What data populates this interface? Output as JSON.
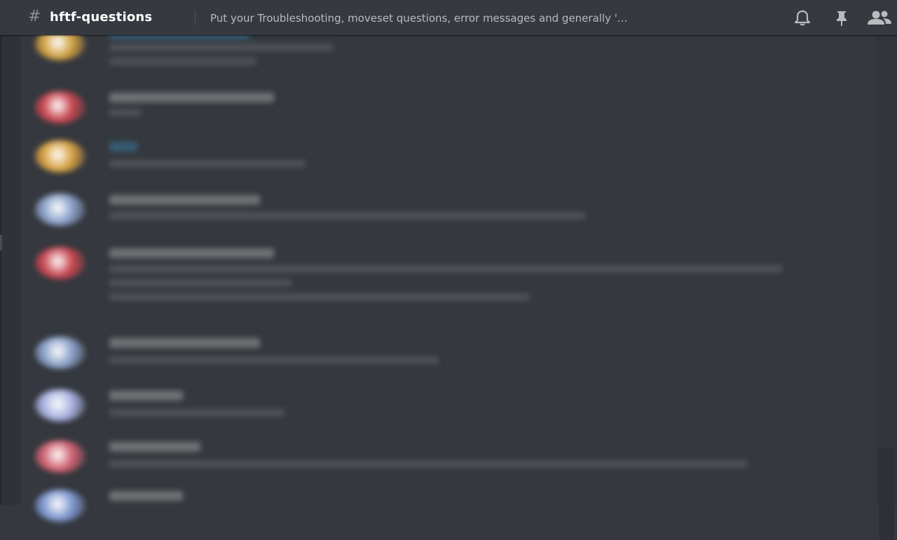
{
  "header": {
    "channel_name": "hftf-questions",
    "topic": "Put your Troubleshooting, moveset questions, error messages and generally '..."
  },
  "icons": {
    "hash": "hash-icon",
    "notifications": "bell-icon",
    "pins": "pin-icon",
    "members": "members-icon"
  },
  "colors": {
    "background": "#36393f",
    "header_text": "#ffffff",
    "topic_text": "#b9bbbe",
    "icon": "#b9bbbe"
  },
  "messages": [
    {
      "username": "",
      "timestamp": "",
      "lines": [
        "",
        ""
      ],
      "avatar_color": "#d0a040",
      "name_color": "#36a3d9"
    },
    {
      "username": "",
      "timestamp": "",
      "lines": [
        ""
      ],
      "avatar_color": "#c8454f",
      "name_color": "#dcddde"
    },
    {
      "username": "",
      "timestamp": "",
      "lines": [
        ""
      ],
      "avatar_color": "#d7a140",
      "name_color": "#36a3d9"
    },
    {
      "username": "",
      "timestamp": "",
      "lines": [
        ""
      ],
      "avatar_color": "#8aa0c8",
      "name_color": "#dcddde"
    },
    {
      "username": "",
      "timestamp": "",
      "lines": [
        "",
        "",
        ""
      ],
      "avatar_color": "#c8454f",
      "name_color": "#dcddde"
    },
    {
      "username": "",
      "timestamp": "",
      "lines": [
        ""
      ],
      "avatar_color": "#8aa0c8",
      "name_color": "#dcddde"
    },
    {
      "username": "",
      "timestamp": "",
      "lines": [
        ""
      ],
      "avatar_color": "#a8b0e0",
      "name_color": "#dcddde"
    },
    {
      "username": "",
      "timestamp": "",
      "lines": [
        ""
      ],
      "avatar_color": "#d06070",
      "name_color": "#dcddde"
    },
    {
      "username": "",
      "timestamp": "",
      "lines": [],
      "avatar_color": "#7f98d0",
      "name_color": "#dcddde"
    }
  ]
}
